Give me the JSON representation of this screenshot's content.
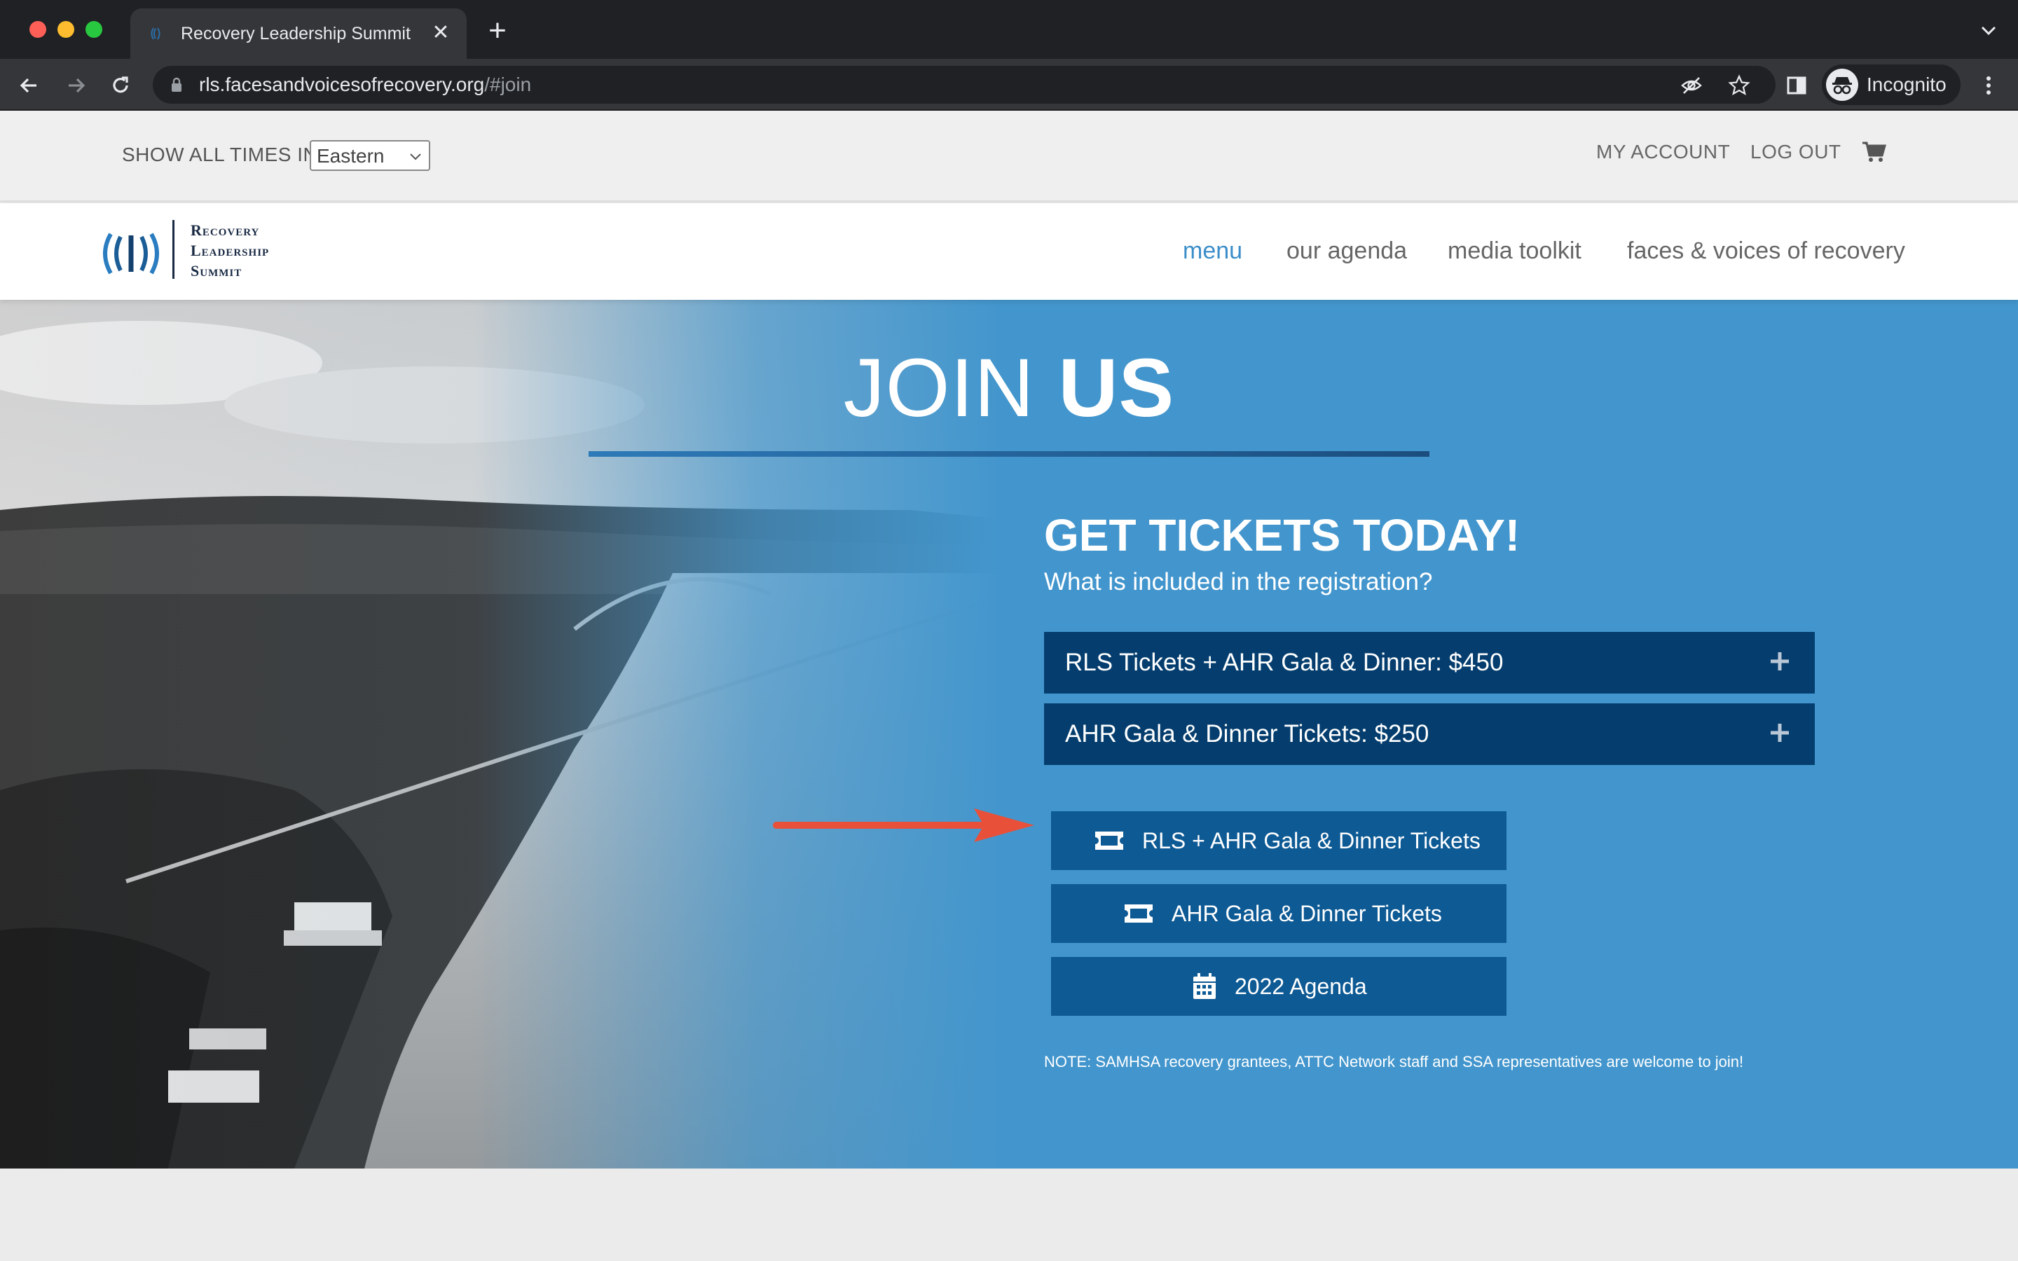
{
  "browser": {
    "tab_title": "Recovery Leadership Summit (",
    "url_host": "rls.facesandvoicesofrecovery.org",
    "url_path": "/#join",
    "profile_label": "Incognito"
  },
  "topbar": {
    "timezone_label": "SHOW ALL TIMES IN",
    "timezone_value": "Eastern",
    "my_account": "MY ACCOUNT",
    "log_out": "LOG OUT"
  },
  "logo": {
    "line1": "Recovery",
    "line2": "Leadership",
    "line3": "Summit"
  },
  "nav": {
    "items": [
      {
        "label": "menu"
      },
      {
        "label": "our agenda"
      },
      {
        "label": "media toolkit"
      },
      {
        "label": "faces & voices of recovery"
      }
    ]
  },
  "hero": {
    "title_light": "JOIN ",
    "title_bold": "US",
    "heading": "GET TICKETS TODAY!",
    "subheading": "What is included in the registration?",
    "accordions": [
      {
        "label": "RLS Tickets + AHR Gala & Dinner: $450"
      },
      {
        "label": "AHR Gala & Dinner Tickets: $250"
      }
    ],
    "buttons": [
      {
        "label": "RLS + AHR Gala & Dinner Tickets",
        "icon": "ticket-icon"
      },
      {
        "label": "AHR Gala & Dinner Tickets",
        "icon": "ticket-icon"
      },
      {
        "label": "2022 Agenda",
        "icon": "calendar-icon"
      }
    ],
    "note": "NOTE: SAMHSA recovery grantees, ATTC Network staff and SSA representatives are welcome to join!"
  },
  "colors": {
    "hero_blue": "#4396cd",
    "accordion_navy": "#053e6e",
    "button_blue": "#0e5a94",
    "nav_active": "#3b8ec9",
    "annotation_arrow": "#e8503a"
  }
}
